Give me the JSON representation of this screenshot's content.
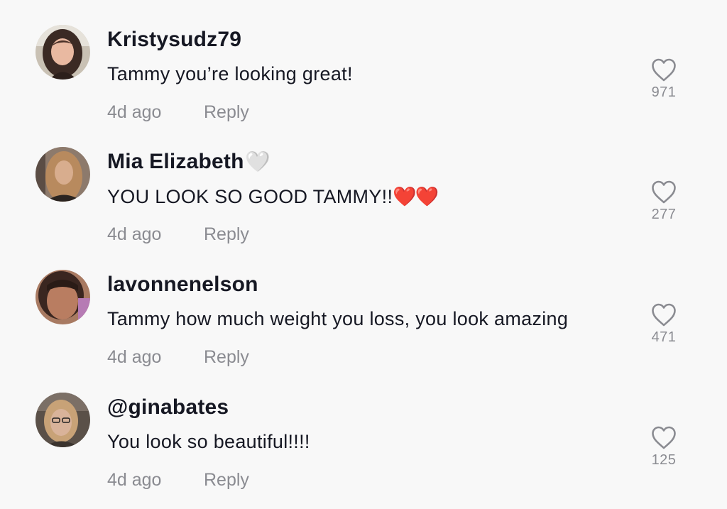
{
  "comments": [
    {
      "username": "Kristysudz79",
      "username_emoji": "",
      "text": "Tammy you’re looking great!",
      "text_emoji": "",
      "time": "4d ago",
      "reply_label": "Reply",
      "likes": "971"
    },
    {
      "username": "Mia Elizabeth",
      "username_emoji": "🤍",
      "text": "YOU LOOK SO GOOD TAMMY!!",
      "text_emoji": "❤️❤️",
      "time": "4d ago",
      "reply_label": "Reply",
      "likes": "277"
    },
    {
      "username": "lavonnenelson",
      "username_emoji": "",
      "text": "Tammy how much weight you loss, you look amazing",
      "text_emoji": "",
      "time": "4d ago",
      "reply_label": "Reply",
      "likes": "471"
    },
    {
      "username": "@ginabates",
      "username_emoji": "",
      "text": "You look so beautiful!!!!",
      "text_emoji": "",
      "time": "4d ago",
      "reply_label": "Reply",
      "likes": "125"
    }
  ],
  "icons": {
    "like": "heart-outline-icon"
  },
  "colors": {
    "background": "#f8f8f8",
    "username": "#161823",
    "text": "#161823",
    "muted": "#8a8b91",
    "heart_emoji": "#e0201f"
  }
}
